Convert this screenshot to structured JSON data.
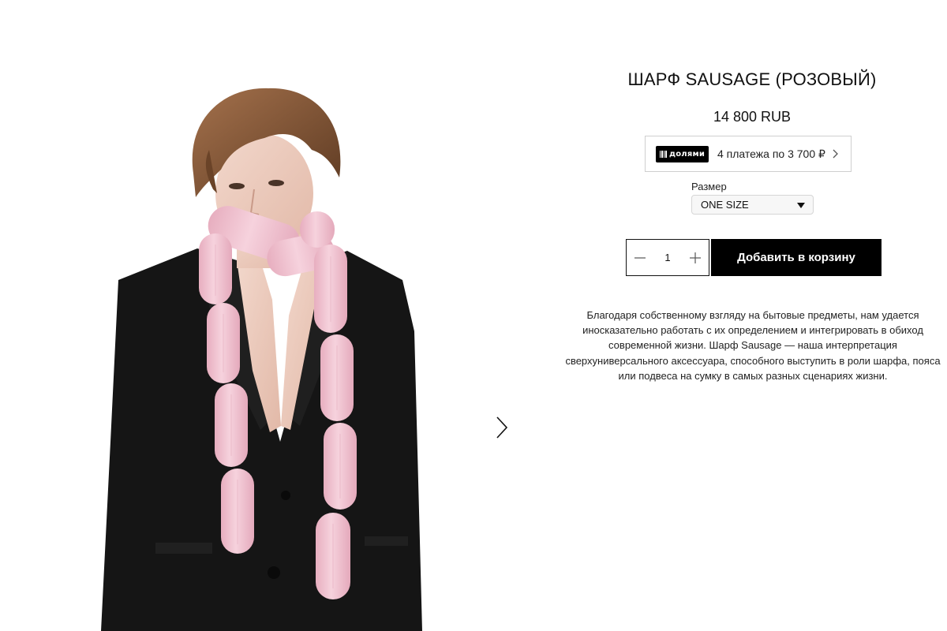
{
  "product": {
    "title": "ШАРФ SAUSAGE (РОЗОВЫЙ)",
    "price": "14 800 RUB",
    "description": "Благодаря собственному взгляду на бытовые предметы, нам удается иносказательно работать с их определением и интегрировать в обиход современной жизни. Шарф Sausage — наша интерпретация сверхуниверсального аксессуара, способного выступить в роли шарфа, пояса или подвеса на сумку в самых разных сценариях жизни."
  },
  "installments": {
    "logo_text": "долями",
    "text": "4 платежа по 3 700 ₽",
    "icon": "chevron-right-icon"
  },
  "size": {
    "label": "Размер",
    "selected": "ONE SIZE"
  },
  "quantity": {
    "value": "1",
    "minus_icon": "minus-icon",
    "plus_icon": "plus-icon"
  },
  "cart": {
    "add_label": "Добавить в корзину"
  },
  "gallery": {
    "next_icon": "chevron-right-icon"
  },
  "colors": {
    "background": "#ffffff",
    "button": "#000000",
    "button_text": "#ffffff",
    "scarf_pink": "#f2c4d3",
    "jacket": "#141414"
  }
}
